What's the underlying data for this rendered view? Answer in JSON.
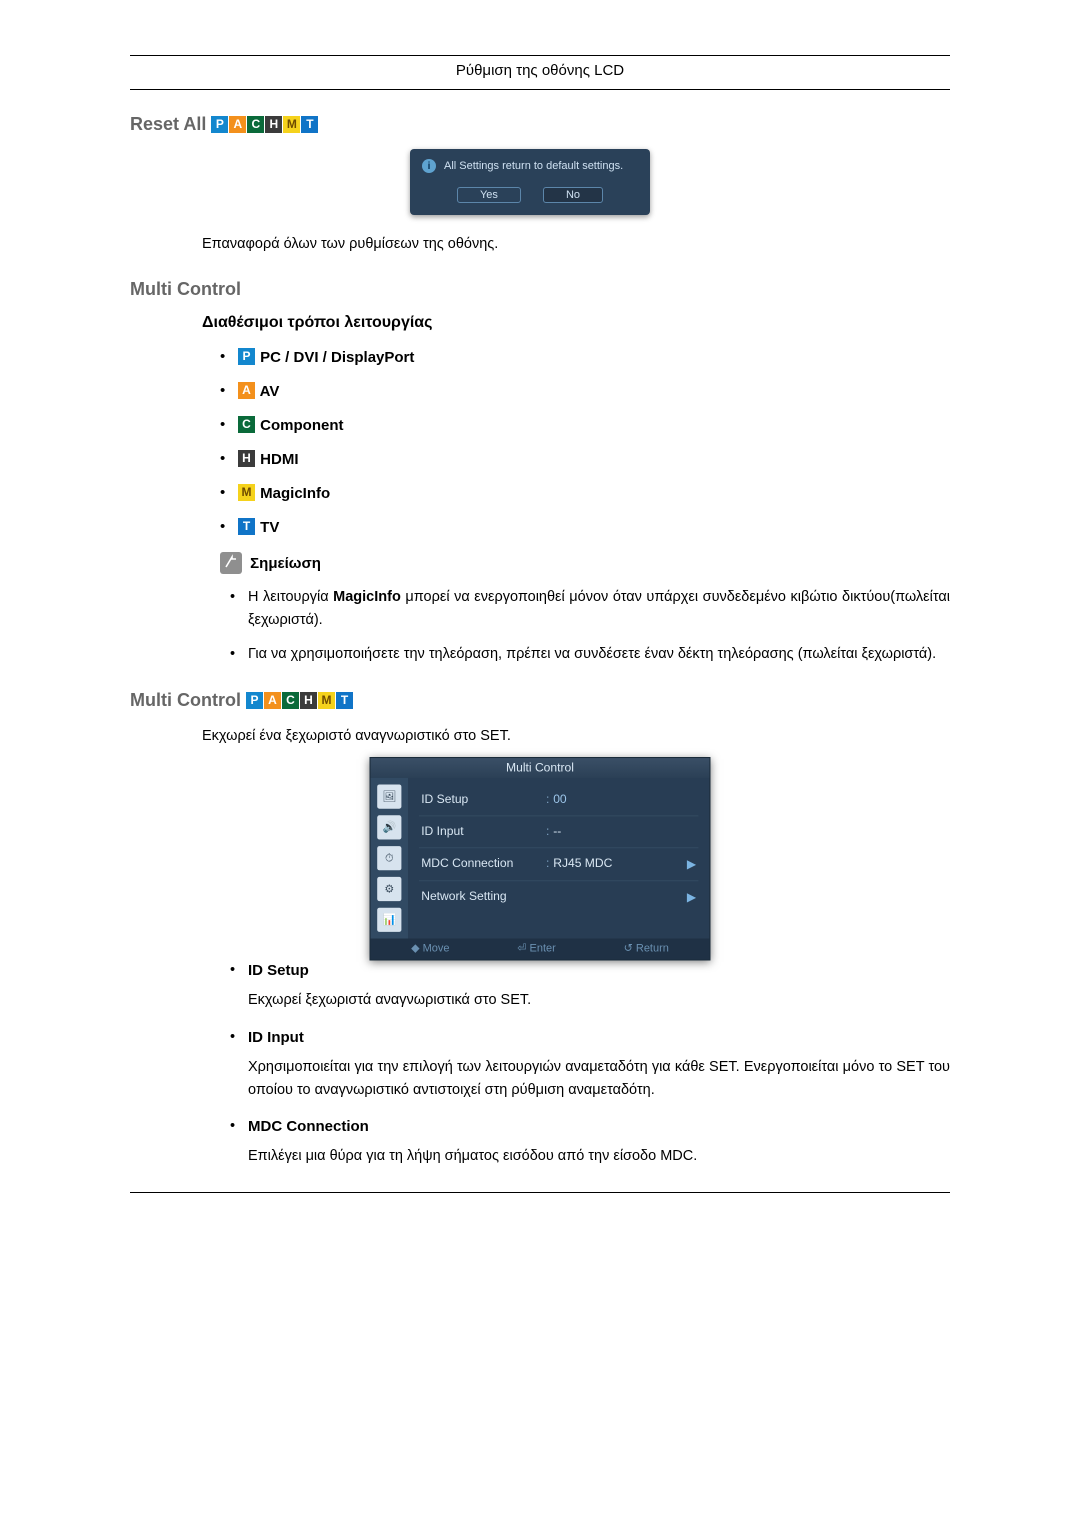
{
  "header": "Ρύθμιση της οθόνης LCD",
  "badges": {
    "P": "P",
    "A": "A",
    "C": "C",
    "H": "H",
    "M": "M",
    "T": "T"
  },
  "reset": {
    "title": "Reset All",
    "dialog_text": "All Settings return to default settings.",
    "yes": "Yes",
    "no": "No",
    "desc": "Επαναφορά όλων των ρυθμίσεων της οθόνης."
  },
  "mc1": {
    "title": "Multi Control",
    "subtitle": "Διαθέσιμοι τρόποι λειτουργίας",
    "modes": {
      "pc": "PC / DVI / DisplayPort",
      "av": "AV",
      "component": "Component",
      "hdmi": "HDMI",
      "magicinfo": "MagicInfo",
      "tv": "TV"
    },
    "note_label": "Σημείωση",
    "notes": {
      "n1a": "Η λειτουργία ",
      "n1b": "MagicInfo",
      "n1c": " μπορεί να ενεργοποιηθεί μόνον όταν υπάρχει συνδεδεμένο κιβώτιο δικτύου(πωλείται ξεχωριστά).",
      "n2": "Για να χρησιμοποιήσετε την τηλεόραση, πρέπει να συνδέσετε έναν δέκτη τηλεόρασης (πωλείται ξεχωριστά)."
    }
  },
  "mc2": {
    "title": "Multi Control",
    "intro": "Εκχωρεί ένα ξεχωριστό αναγνωριστικό στο SET.",
    "osd": {
      "title": "Multi Control",
      "rows": {
        "id_setup": {
          "label": "ID Setup",
          "value": "00"
        },
        "id_input": {
          "label": "ID Input",
          "value": "--"
        },
        "mdc": {
          "label": "MDC Connection",
          "value": "RJ45 MDC"
        },
        "net": {
          "label": "Network Setting",
          "value": ""
        }
      },
      "foot": {
        "move": "◆ Move",
        "enter": "⏎ Enter",
        "ret": "↺ Return"
      }
    },
    "definitions": {
      "id_setup": {
        "term": "ID Setup",
        "desc": "Εκχωρεί ξεχωριστά αναγνωριστικά στο SET."
      },
      "id_input": {
        "term": "ID Input",
        "desc": "Χρησιμοποιείται για την επιλογή των λειτουργιών αναμεταδότη για κάθε SET. Ενεργοποιείται μόνο το SET του οποίου το αναγνωριστικό αντιστοιχεί στη ρύθμιση αναμεταδότη."
      },
      "mdc": {
        "term": "MDC Connection",
        "desc": "Επιλέγει μια θύρα για τη λήψη σήματος εισόδου από την είσοδο MDC."
      }
    }
  }
}
